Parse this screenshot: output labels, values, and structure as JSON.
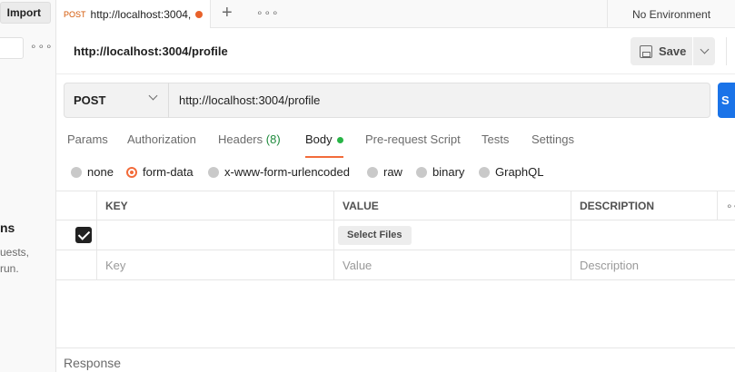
{
  "sidebar": {
    "import_label": "Import",
    "more_glyph": "∘∘∘",
    "empty_title": "ns",
    "empty_line1": "uests,",
    "empty_line2": "run."
  },
  "tabs": {
    "active_method": "POST",
    "active_url": "http://localhost:3004,",
    "unsaved_dot_color": "#e8622b",
    "plus_glyph": "+",
    "more_glyph": "∘∘∘"
  },
  "environment": {
    "label": "No Environment"
  },
  "request": {
    "title": "http://localhost:3004/profile",
    "save_label": "Save",
    "method": "POST",
    "url": "http://localhost:3004/profile",
    "send_label": "S"
  },
  "request_tabs": [
    {
      "label": "Params"
    },
    {
      "label": "Authorization"
    },
    {
      "label": "Headers",
      "count": "(8)"
    },
    {
      "label": "Body"
    },
    {
      "label": "Pre-request Script"
    },
    {
      "label": "Tests"
    },
    {
      "label": "Settings"
    }
  ],
  "body_types": [
    {
      "label": "none",
      "selected": false
    },
    {
      "label": "form-data",
      "selected": true
    },
    {
      "label": "x-www-form-urlencoded",
      "selected": false
    },
    {
      "label": "raw",
      "selected": false
    },
    {
      "label": "binary",
      "selected": false
    },
    {
      "label": "GraphQL",
      "selected": false
    }
  ],
  "table": {
    "headers": {
      "key": "KEY",
      "value": "VALUE",
      "description": "DESCRIPTION",
      "more": "∘∘"
    },
    "row1": {
      "checked": true,
      "file_button": "Select Files"
    },
    "placeholders": {
      "key": "Key",
      "value": "Value",
      "description": "Description"
    }
  },
  "response": {
    "label": "Response"
  },
  "colors": {
    "accent": "#f26b3a",
    "send": "#1a73e8",
    "body_dot": "#28b446"
  }
}
